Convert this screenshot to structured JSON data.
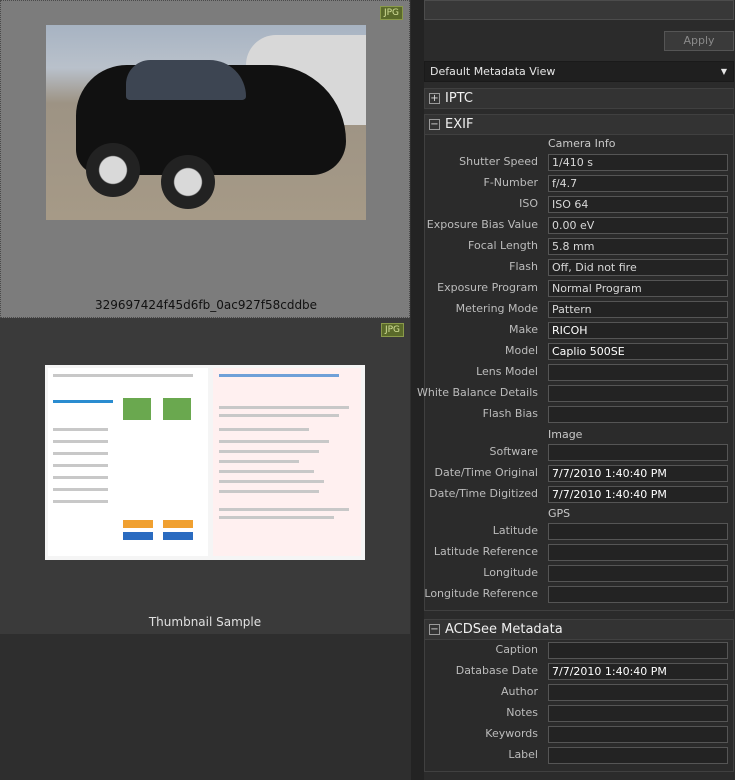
{
  "browser": {
    "items": [
      {
        "badge": "JPG",
        "caption": "329697424f45d6fb_0ac927f58cddbe"
      },
      {
        "badge": "JPG",
        "caption": "Thumbnail Sample"
      }
    ]
  },
  "properties": {
    "apply_label": "Apply",
    "view_select": "Default Metadata View",
    "iptc": {
      "title": "IPTC",
      "toggle": "+"
    },
    "exif": {
      "title": "EXIF",
      "toggle": "−",
      "camera_info_heading": "Camera Info",
      "image_heading": "Image",
      "gps_heading": "GPS",
      "camera_rows": [
        {
          "label": "Shutter Speed",
          "value": "1/410 s"
        },
        {
          "label": "F-Number",
          "value": "f/4.7"
        },
        {
          "label": "ISO",
          "value": "ISO 64"
        },
        {
          "label": "Exposure Bias Value",
          "value": "0.00 eV"
        },
        {
          "label": "Focal Length",
          "value": "5.8 mm"
        },
        {
          "label": "Flash",
          "value": "Off, Did not fire"
        },
        {
          "label": "Exposure Program",
          "value": "Normal Program"
        },
        {
          "label": "Metering Mode",
          "value": "Pattern"
        },
        {
          "label": "Make",
          "value": "RICOH"
        },
        {
          "label": "Model",
          "value": "Caplio 500SE"
        },
        {
          "label": "Lens Model",
          "value": ""
        },
        {
          "label": "White Balance Details",
          "value": ""
        },
        {
          "label": "Flash Bias",
          "value": ""
        }
      ],
      "image_rows": [
        {
          "label": "Software",
          "value": ""
        },
        {
          "label": "Date/Time Original",
          "value": "7/7/2010 1:40:40 PM"
        },
        {
          "label": "Date/Time Digitized",
          "value": "7/7/2010 1:40:40 PM"
        }
      ],
      "gps_rows": [
        {
          "label": "Latitude",
          "value": ""
        },
        {
          "label": "Latitude Reference",
          "value": ""
        },
        {
          "label": "Longitude",
          "value": ""
        },
        {
          "label": "Longitude Reference",
          "value": ""
        }
      ]
    },
    "acdsee": {
      "title": "ACDSee Metadata",
      "toggle": "−",
      "rows": [
        {
          "label": "Caption",
          "value": ""
        },
        {
          "label": "Database Date",
          "value": "7/7/2010 1:40:40 PM"
        },
        {
          "label": "Author",
          "value": ""
        },
        {
          "label": "Notes",
          "value": ""
        },
        {
          "label": "Keywords",
          "value": ""
        },
        {
          "label": "Label",
          "value": ""
        }
      ]
    }
  },
  "colors": {
    "badge_bg": "#5a6a2a",
    "selected_tile": "#7c7c7c",
    "panel_bg": "#2b2b2b"
  }
}
